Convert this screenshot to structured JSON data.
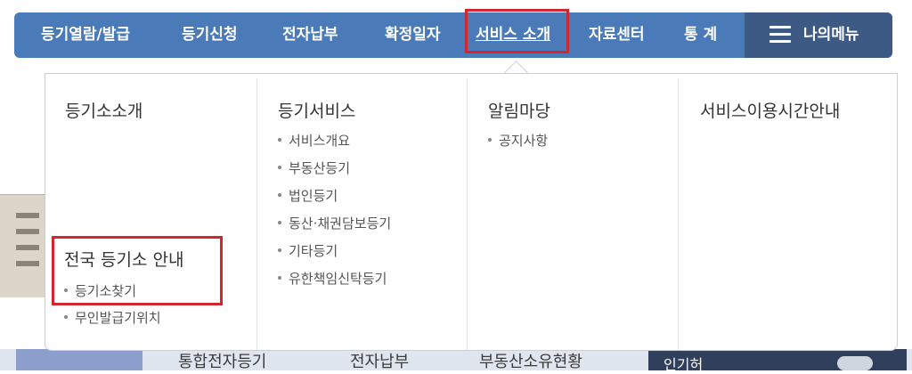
{
  "nav": {
    "items": [
      {
        "label": "등기열람/발급"
      },
      {
        "label": "등기신청"
      },
      {
        "label": "전자납부"
      },
      {
        "label": "확정일자"
      },
      {
        "label": "서비스 소개"
      },
      {
        "label": "자료센터"
      },
      {
        "label": "통 계"
      }
    ],
    "active_index": 4,
    "my_menu_label": "나의메뉴",
    "my_menu_icon": "hamburger-icon",
    "bar_color": "#4a7ab8",
    "highlight_color": "#d0282e"
  },
  "dropdown": {
    "columns": [
      {
        "title": "등기소소개",
        "subtitle": "전국 등기소 안내",
        "items": [
          "등기소찾기",
          "무인발급기위치"
        ]
      },
      {
        "title": "등기서비스",
        "items": [
          "서비스개요",
          "부동산등기",
          "법인등기",
          "동산·채권담보등기",
          "기타등기",
          "유한책임신탁등기"
        ]
      },
      {
        "title": "알림마당",
        "items": [
          "공지사항"
        ]
      },
      {
        "title": "서비스이용시간안내",
        "items": []
      }
    ]
  },
  "background": {
    "bottom_labels": [
      "통합전자등기",
      "전자납부",
      "부동산소유현황"
    ],
    "dark_label": "인기허"
  }
}
